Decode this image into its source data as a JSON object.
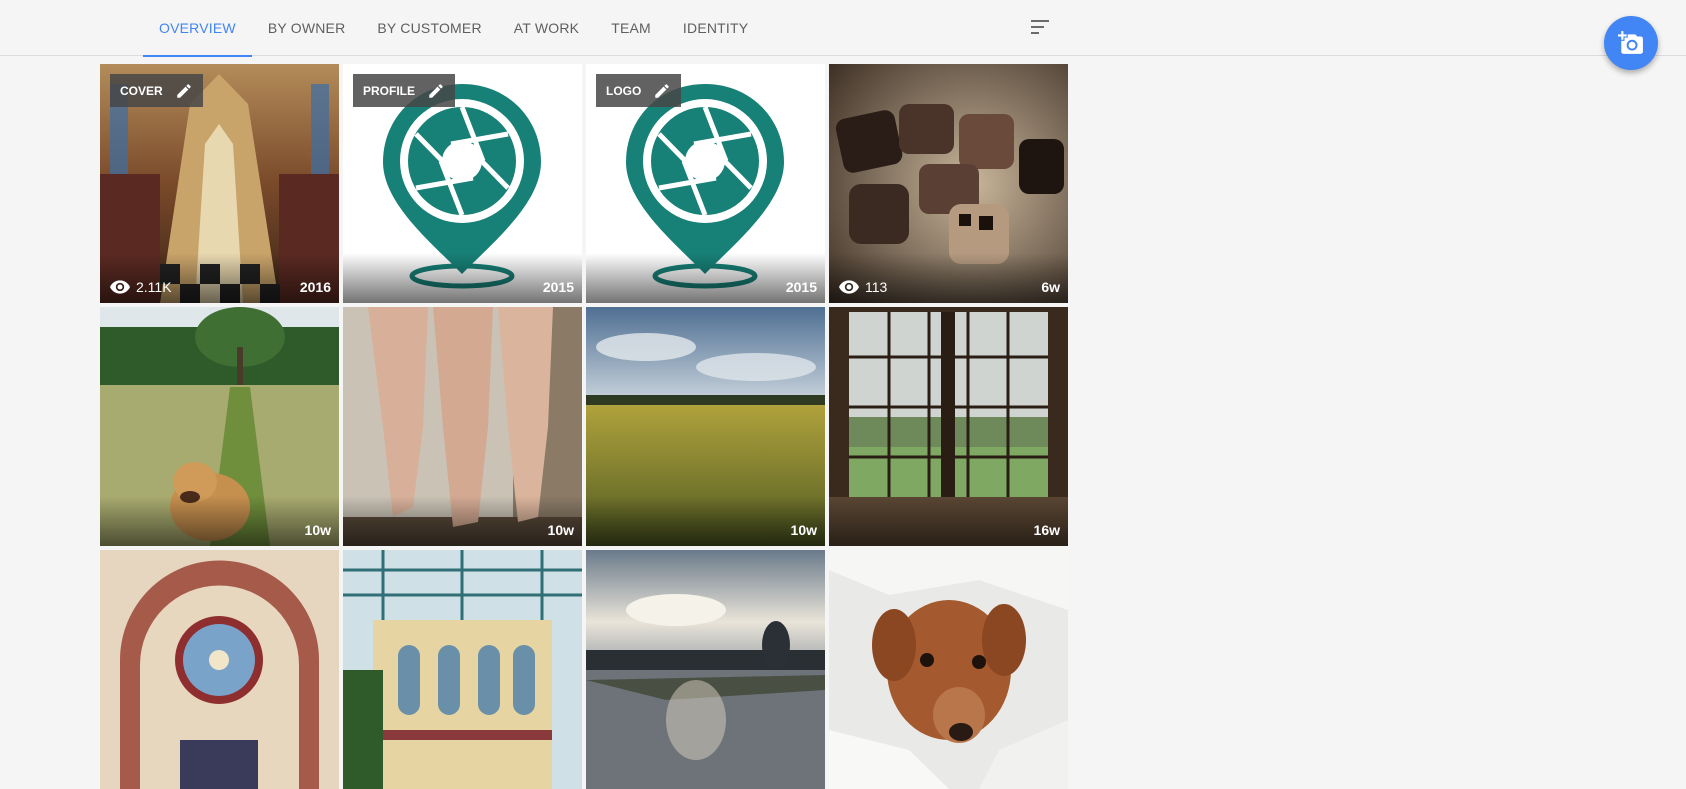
{
  "tabs": [
    {
      "label": "OVERVIEW",
      "active": true
    },
    {
      "label": "BY OWNER",
      "active": false
    },
    {
      "label": "BY CUSTOMER",
      "active": false
    },
    {
      "label": "AT WORK",
      "active": false
    },
    {
      "label": "TEAM",
      "active": false
    },
    {
      "label": "IDENTITY",
      "active": false
    }
  ],
  "toolbar": {
    "sort_icon": "sort-icon",
    "fab_icon": "add-photo-icon",
    "accent": "#4285f4"
  },
  "photos": [
    {
      "chip": "COVER",
      "views": "2.11K",
      "age": "2016",
      "kind": "cathedral"
    },
    {
      "chip": "PROFILE",
      "age": "2015",
      "kind": "logo"
    },
    {
      "chip": "LOGO",
      "age": "2015",
      "kind": "logo"
    },
    {
      "views": "113",
      "age": "6w",
      "kind": "chocolates"
    },
    {
      "age": "10w",
      "kind": "meadow-dog"
    },
    {
      "age": "10w",
      "kind": "legs"
    },
    {
      "age": "10w",
      "kind": "field"
    },
    {
      "age": "16w",
      "kind": "window"
    },
    {
      "age": "",
      "kind": "rose-window"
    },
    {
      "age": "",
      "kind": "glasshouse"
    },
    {
      "age": "",
      "kind": "lake"
    },
    {
      "age": "",
      "kind": "dog-bed"
    }
  ]
}
